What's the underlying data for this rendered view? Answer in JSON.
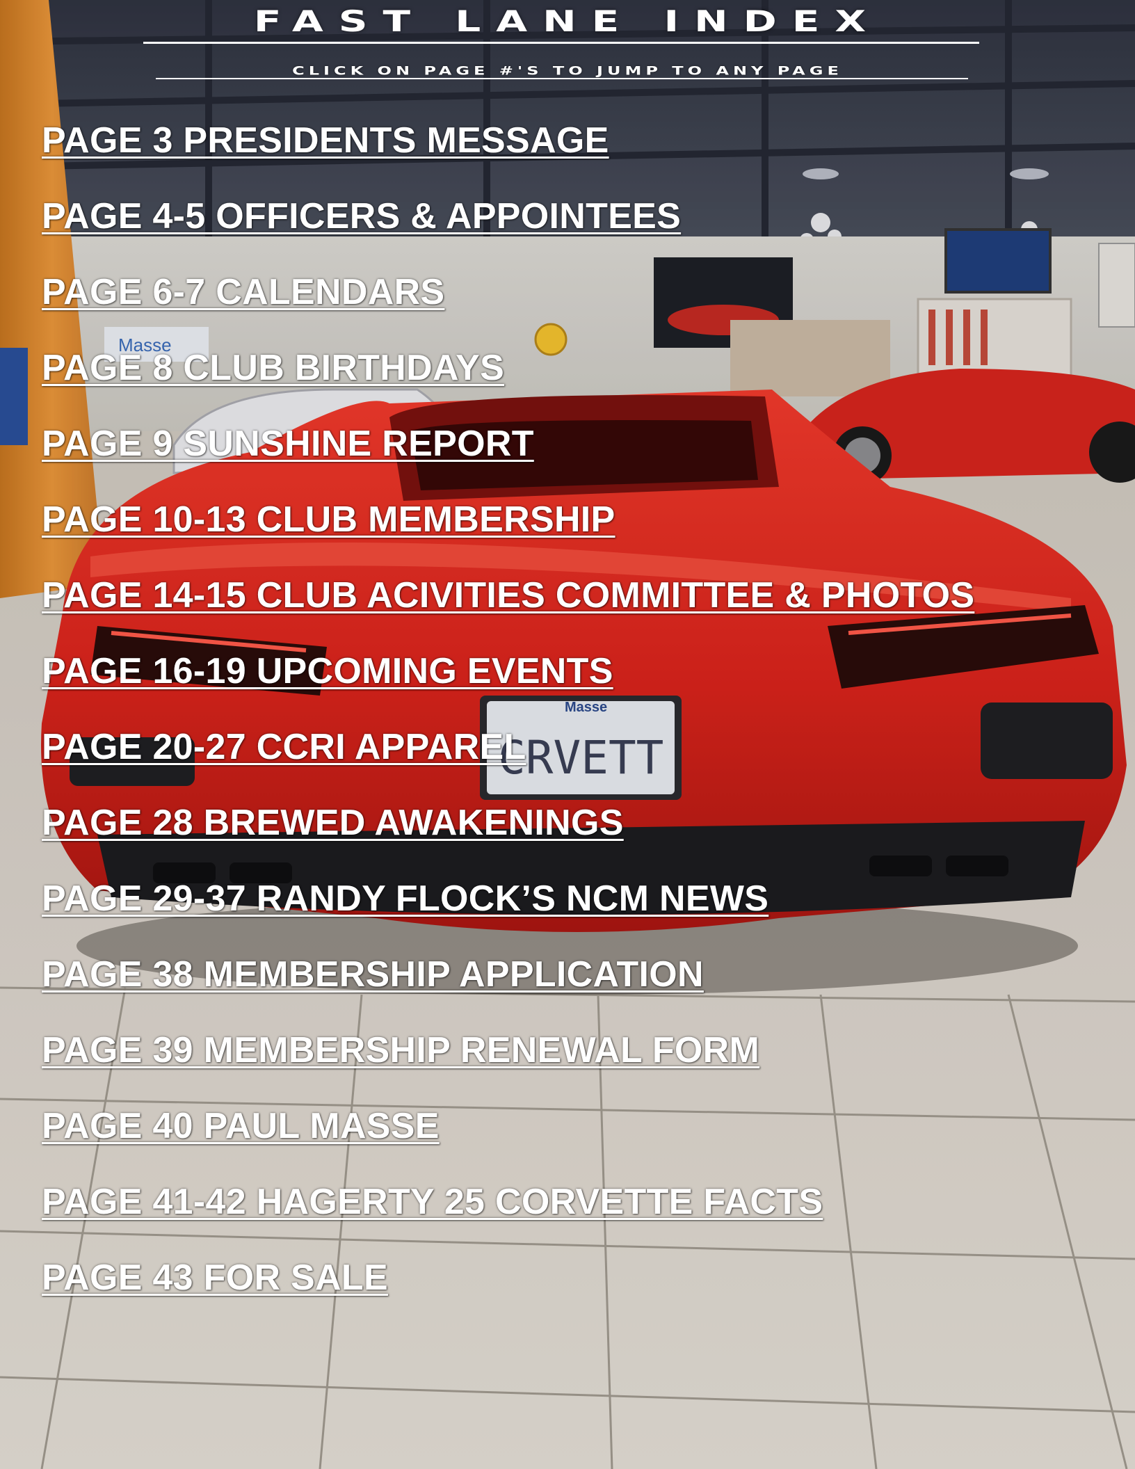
{
  "header": {
    "title": "FAST LANE INDEX",
    "subtitle": "CLICK ON PAGE #'S TO JUMP TO ANY PAGE"
  },
  "index": [
    {
      "label": "PAGE 3 PRESIDENTS MESSAGE"
    },
    {
      "label": "PAGE 4-5 OFFICERS & APPOINTEES"
    },
    {
      "label": "PAGE 6-7 CALENDARS"
    },
    {
      "label": "PAGE 8 CLUB BIRTHDAYS"
    },
    {
      "label": "PAGE 9 SUNSHINE REPORT"
    },
    {
      "label": "PAGE 10-13 CLUB MEMBERSHIP"
    },
    {
      "label": "PAGE 14-15 CLUB ACIVITIES COMMITTEE & PHOTOS"
    },
    {
      "label": "PAGE 16-19 UPCOMING EVENTS"
    },
    {
      "label": "PAGE 20-27 CCRI APPAREL"
    },
    {
      "label": "PAGE 28 BREWED AWAKENINGS"
    },
    {
      "label": "PAGE 29-37 RANDY FLOCK’S NCM NEWS"
    },
    {
      "label": "PAGE 38 MEMBERSHIP APPLICATION"
    },
    {
      "label": "PAGE 39 MEMBERSHIP RENEWAL FORM"
    },
    {
      "label": "PAGE 40 PAUL MASSE"
    },
    {
      "label": "PAGE 41-42 HAGERTY 25 CORVETTE FACTS"
    },
    {
      "label": "PAGE 43 FOR SALE"
    }
  ],
  "photo": {
    "license_plate": "CRVETT",
    "plate_dealer": "Masse",
    "dealer_sign": "Masse"
  },
  "colors": {
    "car_red": "#d9201c",
    "link_text": "#ffffff",
    "pillar_orange": "#e08a2c"
  }
}
